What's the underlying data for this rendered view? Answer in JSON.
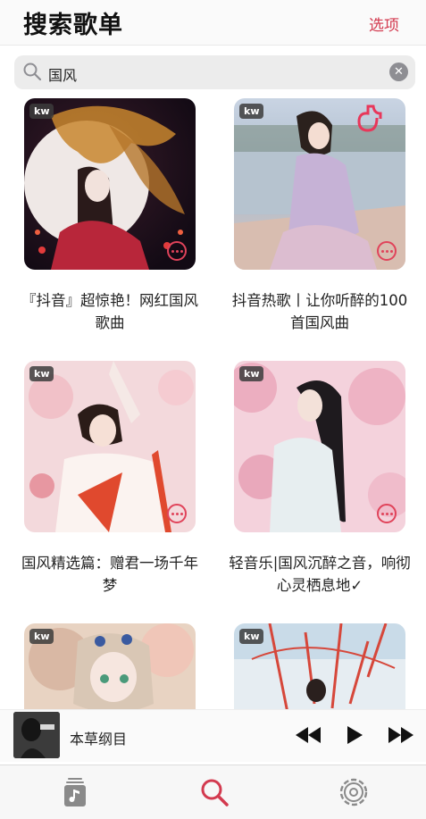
{
  "header": {
    "title": "搜索歌单",
    "options_label": "选项"
  },
  "search": {
    "value": "国风",
    "icon": "search-icon",
    "clear_icon": "clear-icon"
  },
  "playlists": [
    {
      "badge": "kw",
      "title": "『抖音』超惊艳！网红国风歌曲"
    },
    {
      "badge": "kw",
      "title": "抖音热歌丨让你听醉的100首国风曲"
    },
    {
      "badge": "kw",
      "title": "国风精选篇：赠君一场千年梦"
    },
    {
      "badge": "kw",
      "title": "轻音乐|国风沉醉之音，响彻心灵栖息地✓"
    },
    {
      "badge": "kw",
      "title": ""
    },
    {
      "badge": "kw",
      "title": ""
    }
  ],
  "player": {
    "track": "本草纲目",
    "controls": [
      "previous-icon",
      "play-icon",
      "next-icon"
    ]
  },
  "tabs": [
    {
      "name": "library",
      "icon": "music-library-icon"
    },
    {
      "name": "search",
      "icon": "search-icon",
      "active": true
    },
    {
      "name": "settings",
      "icon": "settings-gear-icon"
    }
  ],
  "colors": {
    "accent": "#d33a4f",
    "inactive_tab": "#8a8a8a"
  }
}
